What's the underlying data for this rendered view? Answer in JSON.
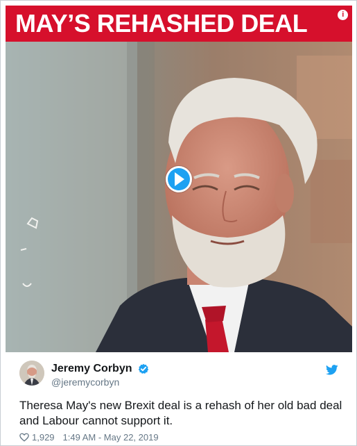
{
  "media": {
    "banner_title": "MAY’S REHASHED DEAL",
    "banner_info_glyph": "i",
    "play_icon": "play-icon",
    "colors": {
      "banner_red": "#d6102c",
      "play_blue": "#1da1f2"
    }
  },
  "tweet": {
    "display_name": "Jeremy Corbyn",
    "handle": "@jeremycorbyn",
    "verified_icon": "verified-badge-icon",
    "brand_icon": "twitter-bird-icon",
    "text": "Theresa May's new Brexit deal is a rehash of her old bad deal and Labour cannot support it.",
    "likes": "1,929",
    "timestamp": "1:49 AM - May 22, 2019",
    "colors": {
      "brand": "#1da1f2",
      "muted": "#657786"
    }
  }
}
